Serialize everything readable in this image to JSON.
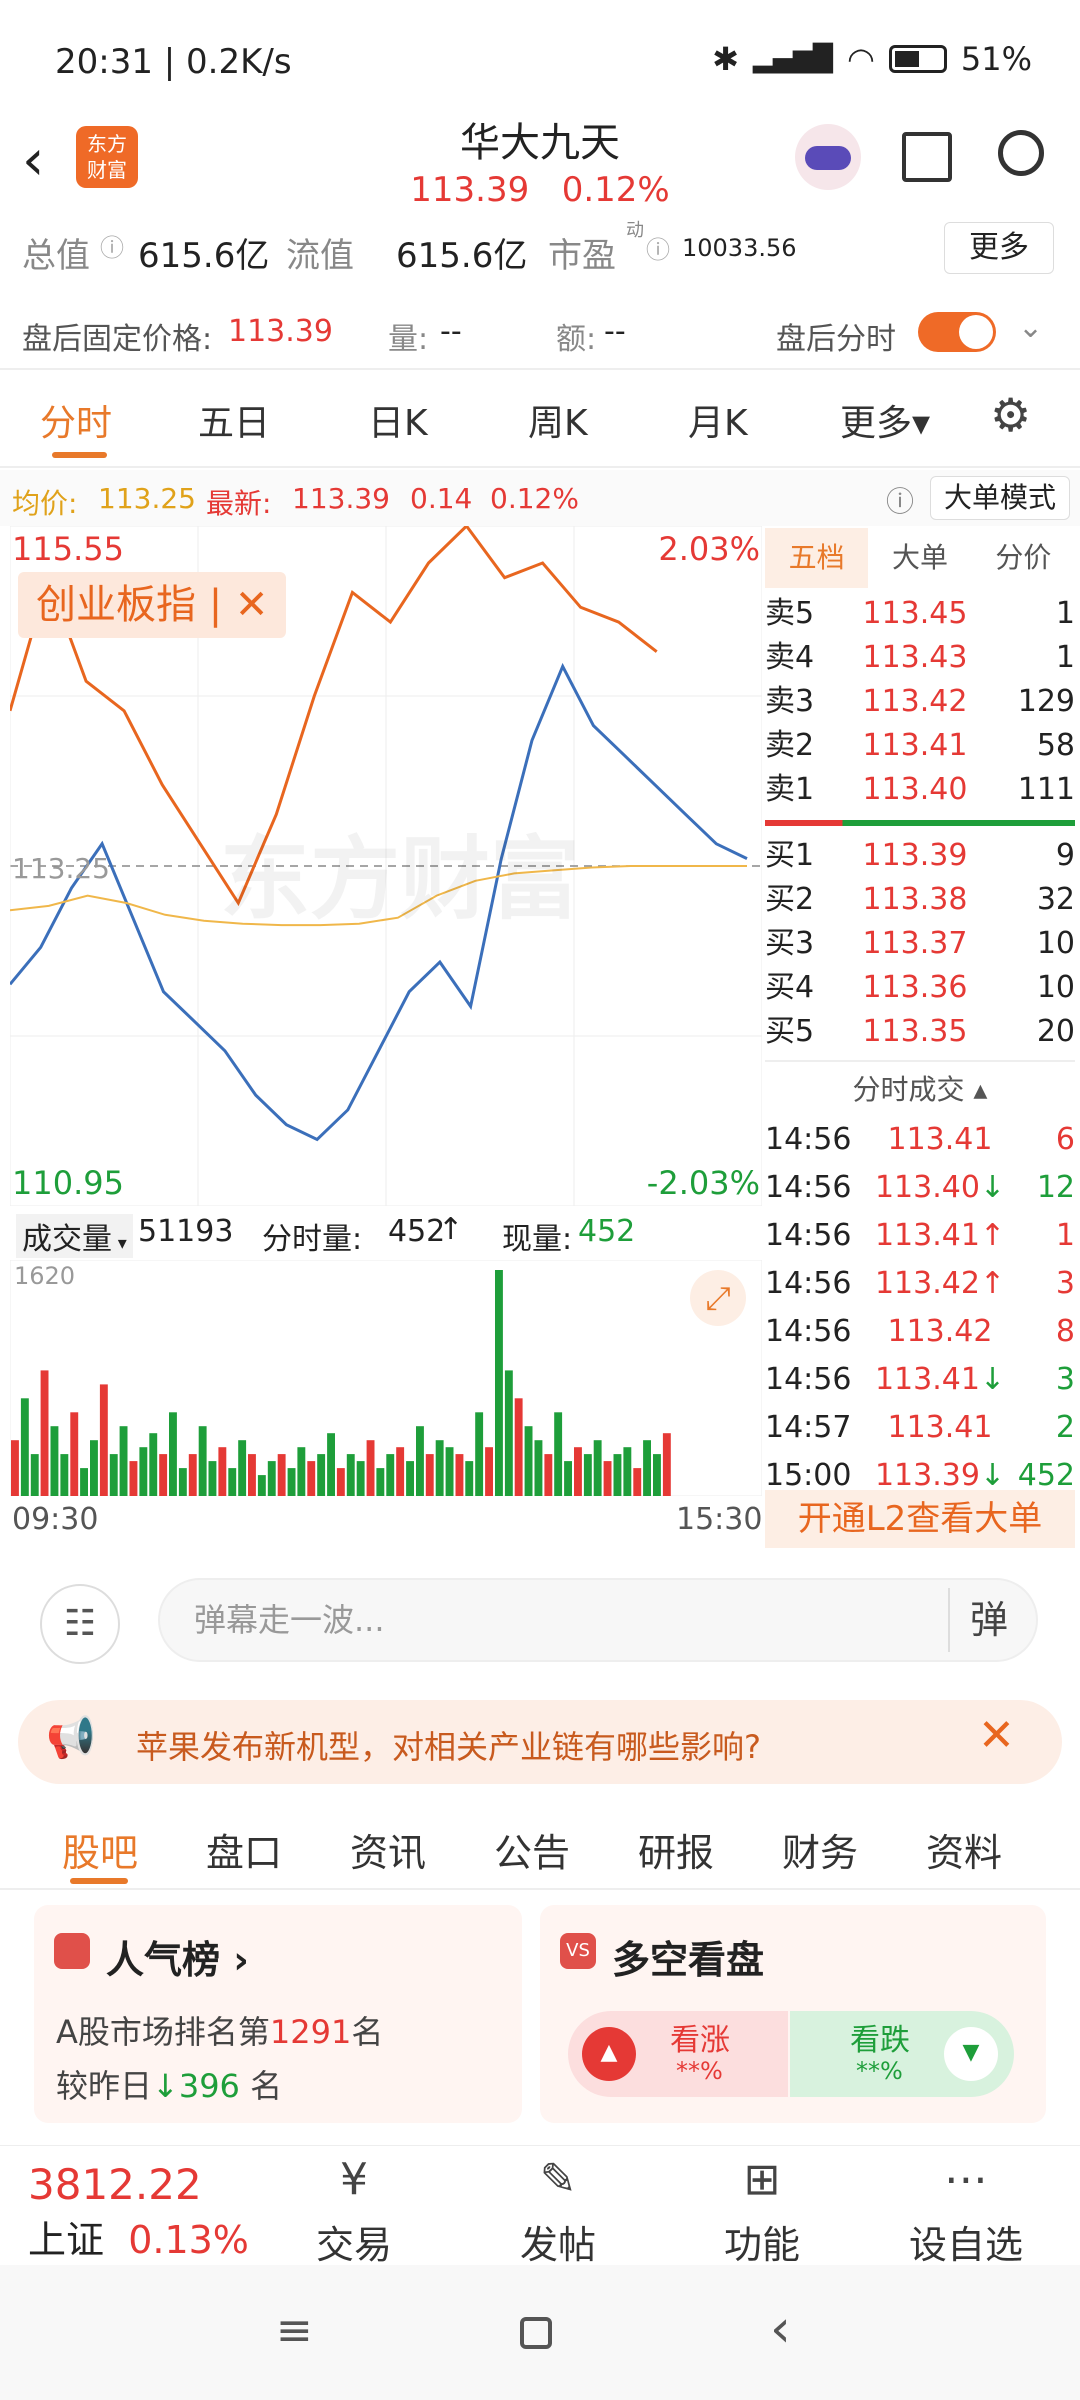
{
  "status": {
    "time": "20:31 | 0.2K/s",
    "battery": "51%"
  },
  "header": {
    "logo": "东方\n财富",
    "title": "华大九天",
    "price": "113.39",
    "change_pct": "0.12%"
  },
  "stats": {
    "total_label": "总值",
    "total": "615.6亿",
    "float_label": "流值",
    "float": "615.6亿",
    "pe_label": "市盈",
    "pe_sup": "动",
    "pe": "10033.56",
    "more": "更多"
  },
  "after": {
    "fixed_label": "盘后固定价格:",
    "fixed_price": "113.39",
    "vol_label": "量:",
    "vol": "--",
    "amt_label": "额:",
    "amt": "--",
    "toggle_label": "盘后分时"
  },
  "tabs": [
    "分时",
    "五日",
    "日K",
    "周K",
    "月K",
    "更多▾"
  ],
  "priceline": {
    "avg_label": "均价:",
    "avg": "113.25",
    "last_label": "最新:",
    "last": "113.39",
    "chg": "0.14",
    "pct": "0.12%",
    "mode": "大单模式"
  },
  "chart": {
    "top_price": "115.55",
    "top_pct": "2.03%",
    "bottom_price": "110.95",
    "bottom_pct": "-2.03%",
    "ref_price": "113.25",
    "index_tag": "创业板指 | ✕",
    "watermark": "东方财富"
  },
  "volume_bar": {
    "label": "成交量",
    "total": "51193",
    "minute_label": "分时量:",
    "minute": "452",
    "now_label": "现量:",
    "now": "452",
    "max": "1620",
    "start": "09:30",
    "end": "15:30"
  },
  "order_book": {
    "tabs": [
      "五档",
      "大单",
      "分价"
    ],
    "asks": [
      {
        "label": "卖5",
        "price": "113.45",
        "vol": "1"
      },
      {
        "label": "卖4",
        "price": "113.43",
        "vol": "1"
      },
      {
        "label": "卖3",
        "price": "113.42",
        "vol": "129"
      },
      {
        "label": "卖2",
        "price": "113.41",
        "vol": "58"
      },
      {
        "label": "卖1",
        "price": "113.40",
        "vol": "111"
      }
    ],
    "bids": [
      {
        "label": "买1",
        "price": "113.39",
        "vol": "9"
      },
      {
        "label": "买2",
        "price": "113.38",
        "vol": "32"
      },
      {
        "label": "买3",
        "price": "113.37",
        "vol": "10"
      },
      {
        "label": "买4",
        "price": "113.36",
        "vol": "10"
      },
      {
        "label": "买5",
        "price": "113.35",
        "vol": "20"
      }
    ],
    "trades_title": "分时成交 ▴",
    "trades": [
      {
        "t": "14:56",
        "p": "113.41",
        "a": "",
        "v": "6",
        "c": "red"
      },
      {
        "t": "14:56",
        "p": "113.40",
        "a": "↓",
        "v": "12",
        "c": "green"
      },
      {
        "t": "14:56",
        "p": "113.41",
        "a": "↑",
        "v": "1",
        "c": "red"
      },
      {
        "t": "14:56",
        "p": "113.42",
        "a": "↑",
        "v": "3",
        "c": "red"
      },
      {
        "t": "14:56",
        "p": "113.42",
        "a": "",
        "v": "8",
        "c": "red"
      },
      {
        "t": "14:56",
        "p": "113.41",
        "a": "↓",
        "v": "3",
        "c": "green"
      },
      {
        "t": "14:57",
        "p": "113.41",
        "a": "",
        "v": "2",
        "c": "green"
      },
      {
        "t": "15:00",
        "p": "113.39",
        "a": "↓",
        "v": "452",
        "c": "green"
      }
    ],
    "l2": "开通L2查看大单"
  },
  "danmaku": {
    "placeholder": "弹幕走一波...",
    "btn": "弹"
  },
  "banner": {
    "text": "苹果发布新机型，对相关产业链有哪些影响?"
  },
  "bottom_tabs": [
    "股吧",
    "盘口",
    "资讯",
    "公告",
    "研报",
    "财务",
    "资料"
  ],
  "popularity": {
    "title": "人气榜 ›",
    "rank_prefix": "A股市场排名第",
    "rank": "1291",
    "rank_suffix": "名",
    "change_prefix": "较昨日",
    "change": "396",
    "change_suffix": "名"
  },
  "bullbear": {
    "title": "多空看盘",
    "up_label": "看涨",
    "up_val": "**%",
    "down_label": "看跌",
    "down_val": "**%"
  },
  "index": {
    "value": "3812.22",
    "name": "上证",
    "pct": "0.13%"
  },
  "nav": [
    "交易",
    "发帖",
    "功能",
    "设自选"
  ],
  "colors": {
    "accent": "#e8792a",
    "up": "#e53935",
    "down": "#1e9e3a",
    "avg_line": "#f0b74a",
    "index_line": "#e8661f",
    "price_line": "#3b6fba"
  },
  "chart_data": {
    "type": "line",
    "x_range": [
      "09:30",
      "15:30"
    ],
    "ylim": [
      110.95,
      115.55
    ],
    "reference": 113.25,
    "series": [
      {
        "values": [
          112.45,
          112.7,
          113.1,
          113.4,
          112.9,
          112.4,
          112.2,
          112.0,
          111.7,
          111.5,
          111.4,
          111.6,
          112.0,
          112.4,
          112.6,
          112.3,
          113.3,
          114.1,
          114.6,
          114.2,
          114.0,
          113.8,
          113.6,
          113.4,
          113.3
        ]
      },
      {
        "values": [
          112.95,
          112.98,
          113.05,
          113.0,
          112.92,
          112.88,
          112.86,
          112.85,
          112.85,
          112.86,
          112.9,
          113.05,
          113.15,
          113.2,
          113.22,
          113.24,
          113.25,
          113.25,
          113.25,
          113.25
        ]
      },
      {
        "values": [
          114.3,
          115.2,
          114.5,
          114.3,
          113.8,
          113.4,
          113.0,
          113.6,
          114.4,
          115.1,
          114.9,
          115.3,
          115.55,
          115.2,
          115.3,
          115.0,
          114.9,
          114.7
        ]
      }
    ],
    "volume": [
      400,
      700,
      300,
      900,
      500,
      300,
      600,
      200,
      400,
      800,
      300,
      500,
      250,
      350,
      450,
      300,
      600,
      200,
      300,
      500,
      250,
      350,
      200,
      400,
      300,
      150,
      250,
      300,
      200,
      350,
      250,
      300,
      450,
      200,
      300,
      250,
      400,
      200,
      300,
      350,
      250,
      500,
      300,
      400,
      350,
      300,
      250,
      600,
      350,
      1620,
      900,
      700,
      500,
      400,
      300,
      600,
      250,
      350,
      300,
      400,
      250,
      300,
      350,
      200,
      400,
      300,
      450
    ]
  }
}
